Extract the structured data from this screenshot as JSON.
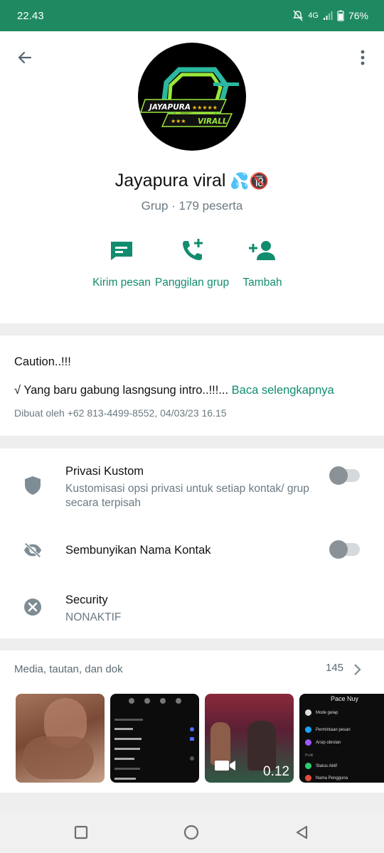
{
  "status_bar": {
    "time": "22.43",
    "network": "4G",
    "battery": "76%",
    "icons": [
      "mute-icon",
      "signal-icon",
      "battery-icon"
    ]
  },
  "header": {
    "back_icon": "arrow-left-icon",
    "menu_icon": "more-vertical-icon",
    "avatar_text_top": "JAYAPURA",
    "avatar_text_bottom": "VIRALL",
    "group_name": "Jayapura viral",
    "group_name_emoji": "💦🔞",
    "group_meta": "Grup · 179 peserta"
  },
  "actions": [
    {
      "label": "Kirim pesan",
      "icon": "message-icon"
    },
    {
      "label": "Panggilan grup",
      "icon": "call-add-icon"
    },
    {
      "label": "Tambah",
      "icon": "add-person-icon"
    }
  ],
  "description": {
    "line1": "Caution..!!!",
    "line2": "√ Yang baru gabung lasngsung intro..!!!...",
    "read_more": "Baca selengkapnya",
    "created_by": "Dibuat oleh +62 813-4499-8552, 04/03/23 16.15"
  },
  "settings": [
    {
      "title": "Privasi Kustom",
      "subtitle": "Kustomisasi opsi privasi untuk setiap kontak/ grup secara terpisah",
      "icon": "shield-icon",
      "toggle": false
    },
    {
      "title": "Sembunyikan Nama Kontak",
      "subtitle": "",
      "icon": "eye-off-icon",
      "toggle": false
    },
    {
      "title": "Security",
      "subtitle": "NONAKTIF",
      "icon": "close-circle-icon"
    }
  ],
  "media": {
    "label": "Media, tautan, dan dok",
    "count": "145",
    "video_duration": "0.12",
    "thumb4_header": "Pace Nuy",
    "thumb4_items": [
      "Mode gelap",
      "Permintaan pesan",
      "Arsip obrolan",
      "Status Aktif",
      "Nama Pengguna"
    ],
    "thumb4_section": "Profil"
  },
  "colors": {
    "status_bar": "#1f8a61",
    "accent": "#128c6e",
    "secondary_text": "#6b7a82"
  }
}
